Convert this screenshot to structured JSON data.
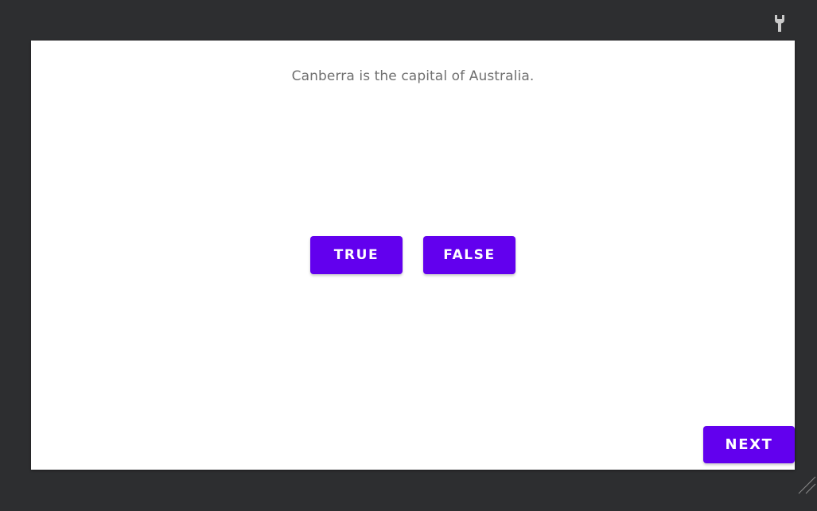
{
  "question": {
    "text": "Canberra is the capital of Australia."
  },
  "answers": {
    "true_label": "TRUE",
    "false_label": "FALSE"
  },
  "navigation": {
    "next_label": "NEXT"
  },
  "toolbar": {
    "icon": "wrench-icon"
  },
  "colors": {
    "accent": "#6200ee",
    "background": "#2d2e30",
    "surface": "#ffffff",
    "question_text": "#6f6f6f"
  }
}
